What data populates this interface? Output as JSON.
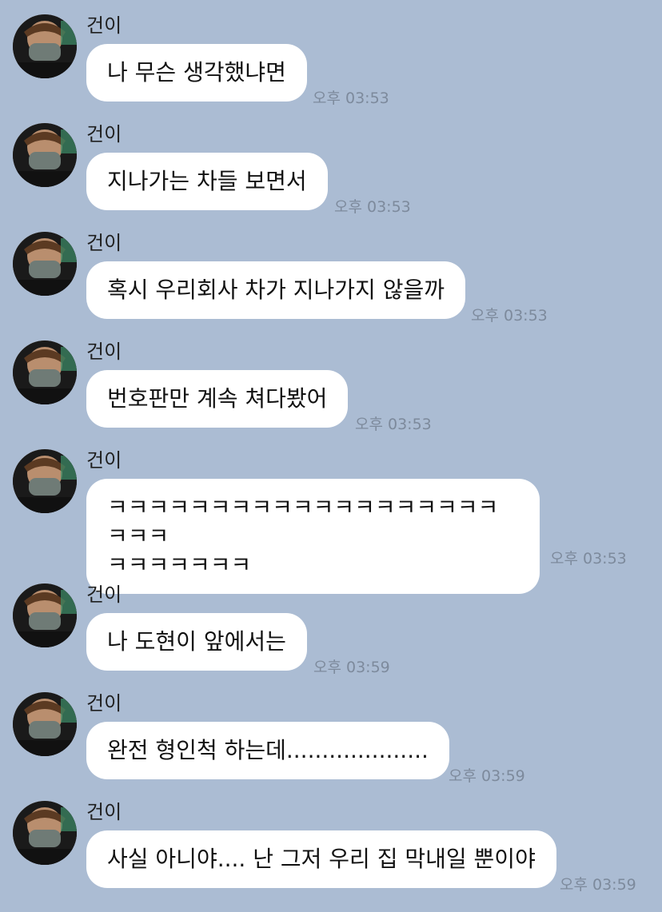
{
  "sender_name": "건이",
  "messages": [
    {
      "text": "나 무슨 생각했냐면",
      "time": "오후 03:53"
    },
    {
      "text": "지나가는 차들 보면서",
      "time": "오후 03:53"
    },
    {
      "text": "혹시 우리회사 차가 지나가지 않을까",
      "time": "오후 03:53"
    },
    {
      "text": "번호판만 계속 쳐다봤어",
      "time": "오후 03:53"
    },
    {
      "text_line1": "ㅋㅋㅋㅋㅋㅋㅋㅋㅋㅋㅋㅋㅋㅋㅋㅋㅋㅋㅋㅋㅋㅋ",
      "text_line2": "ㅋㅋㅋㅋㅋㅋㅋ",
      "time": "오후 03:53"
    },
    {
      "text": "나 도현이 앞에서는",
      "time": "오후 03:59"
    },
    {
      "text": "완전 형인척 하는데....................",
      "time": "오후 03:59"
    },
    {
      "text": "사실 아니야.... 난 그저 우리 집 막내일 뿐이야",
      "time": "오후 03:59"
    }
  ]
}
